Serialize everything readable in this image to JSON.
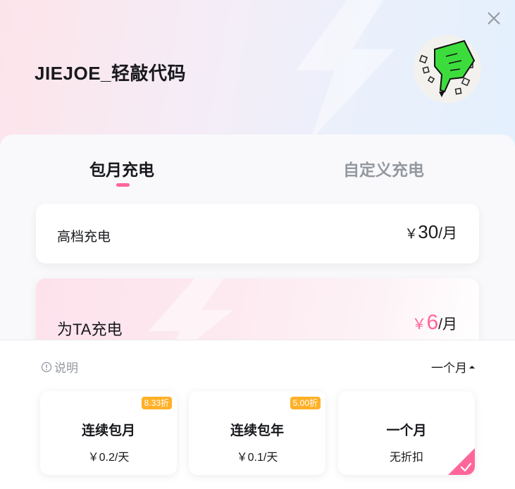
{
  "header": {
    "title": "JIEJOE_轻敲代码",
    "close_icon": "close-icon",
    "avatar_icon": "finger-avatar-icon"
  },
  "tabs": [
    {
      "label": "包月充电",
      "active": true
    },
    {
      "label": "自定义充电",
      "active": false
    }
  ],
  "tiers": [
    {
      "label": "高档充电",
      "currency": "￥",
      "amount": "30",
      "unit": "/月"
    },
    {
      "label": "为TA充电",
      "currency": "￥",
      "amount": "6",
      "unit": "/月"
    }
  ],
  "footer": {
    "explain_label": "说明",
    "explain_icon": "info-circle-icon",
    "period_label": "一个月",
    "period_icon": "caret-up-icon"
  },
  "options": [
    {
      "name": "连续包月",
      "price": "￥0.2/天",
      "badge": "8.33折",
      "selected": false
    },
    {
      "name": "连续包年",
      "price": "￥0.1/天",
      "badge": "5.00折",
      "selected": false
    },
    {
      "name": "一个月",
      "price": "无折扣",
      "selected": true
    }
  ],
  "colors": {
    "accent": "#ff6699",
    "badge": "#ffb027",
    "text": "#18191c",
    "muted": "#9499a0"
  }
}
